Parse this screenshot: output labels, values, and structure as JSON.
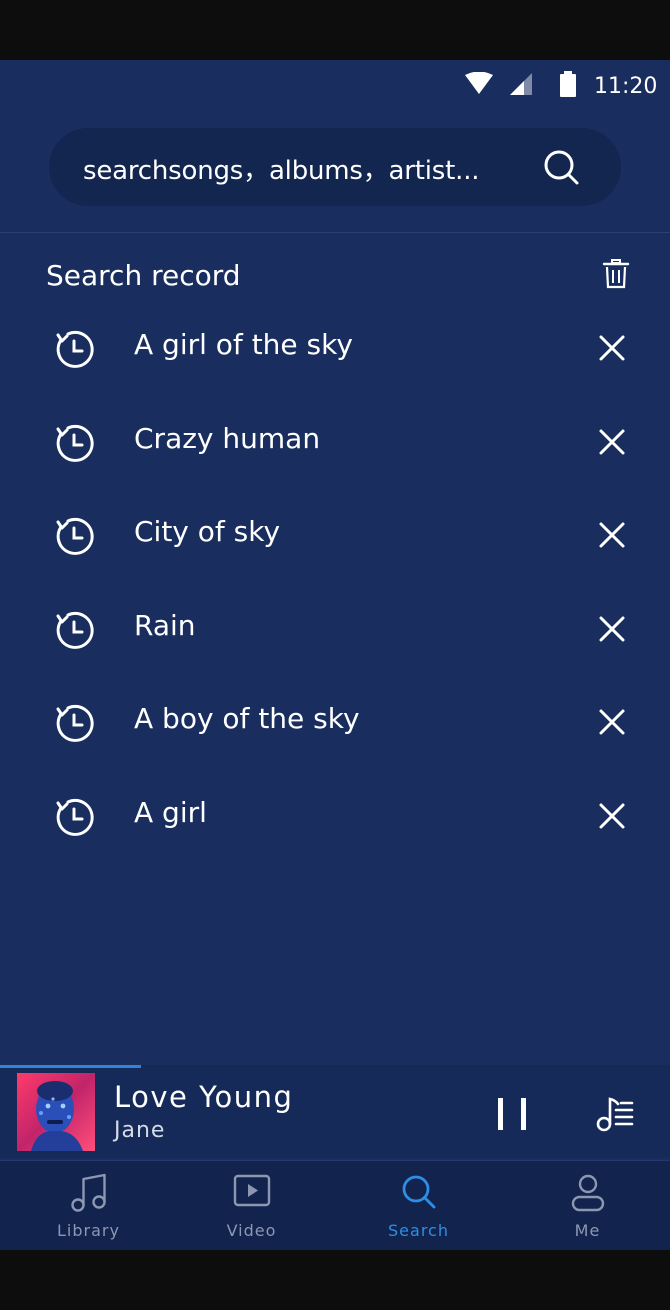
{
  "status_bar": {
    "time": "11:20"
  },
  "search": {
    "placeholder": "searchsongs，albums，artist..."
  },
  "search_record": {
    "title": "Search record",
    "items": [
      {
        "label": "A girl of the sky"
      },
      {
        "label": "Crazy human"
      },
      {
        "label": "City of sky"
      },
      {
        "label": "Rain"
      },
      {
        "label": "A boy of the sky"
      },
      {
        "label": "A girl"
      }
    ]
  },
  "now_playing": {
    "title": "Love Young",
    "artist": "Jane",
    "progress": 0.21
  },
  "tabs": [
    {
      "label": "Library",
      "icon": "music-note-icon",
      "active": false
    },
    {
      "label": "Video",
      "icon": "play-icon",
      "active": false
    },
    {
      "label": "Search",
      "icon": "search-icon",
      "active": true
    },
    {
      "label": "Me",
      "icon": "person-icon",
      "active": false
    }
  ],
  "colors": {
    "background": "#192e5e",
    "accent": "#2d8ee6",
    "player_bg": "#152a58",
    "tabbar_bg": "#12244d"
  }
}
